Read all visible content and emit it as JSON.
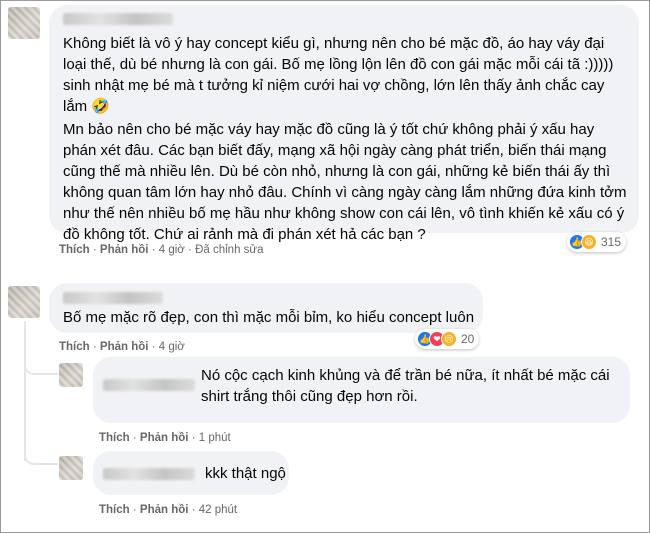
{
  "comments": [
    {
      "text": "Không biết là vô ý hay concept kiểu gì, nhưng nên cho bé mặc đồ, áo hay váy đại\nloại thế, dù bé nhưng là con gái. Bố mẹ lồng lộn lên đồ con gái mặc mỗi cái tã :)))))\nsinh nhật mẹ bé mà t tưởng kỉ niệm cưới hai vợ chồng, lớn lên thấy ảnh chắc cay\nlắm 🤣",
      "text2": "Mn bảo nên cho bé mặc váy hay mặc đồ cũng là ý tốt chứ không phải ý xấu hay\nphán xét đâu. Các bạn biết đấy, mạng xã hội ngày càng phát triển, biến thái mạng\ncũng thế mà nhiều lên. Dù bé còn nhỏ, nhưng là con gái, những kẻ biến thái ấy thì\nkhông quan tâm lớn hay nhỏ đâu. Chính vì càng ngày càng lắm những đứa kinh tởm\nnhư thế nên nhiều bố mẹ hầu như không show con cái lên, vô tình khiến kẻ xấu có ý\nđồ không tốt. Chứ ai rảnh mà đi phán xét hả các bạn ?",
      "like_label": "Thích",
      "reply_label": "Phản hồi",
      "time": "4 giờ",
      "edited": "Đã chỉnh sửa",
      "reaction_count": "315",
      "reaction_icons": [
        "like-icon",
        "haha-icon"
      ]
    },
    {
      "text": "Bố mẹ mặc rõ đẹp, con thì mặc mỗi bỉm, ko hiểu concept luôn",
      "like_label": "Thích",
      "reply_label": "Phản hồi",
      "time": "4 giờ",
      "reaction_count": "20",
      "reaction_icons": [
        "like-icon",
        "love-icon",
        "sad-icon"
      ]
    }
  ],
  "replies": [
    {
      "text": "Nó cộc cạch kinh khủng và để trần bé nữa, ít nhất bé mặc cái\nshirt trắng thôi cũng đẹp hơn rồi.",
      "like_label": "Thích",
      "reply_label": "Phản hồi",
      "time": "1 phút"
    },
    {
      "text": "kkk thật ngộ",
      "like_label": "Thích",
      "reply_label": "Phản hồi",
      "time": "42 phút"
    }
  ],
  "separator": "·",
  "colors": {
    "bubble": "#f0f2f5",
    "meta": "#65676b",
    "like": "#1877f2",
    "love": "#f33e58",
    "haha": "#f7b125"
  }
}
